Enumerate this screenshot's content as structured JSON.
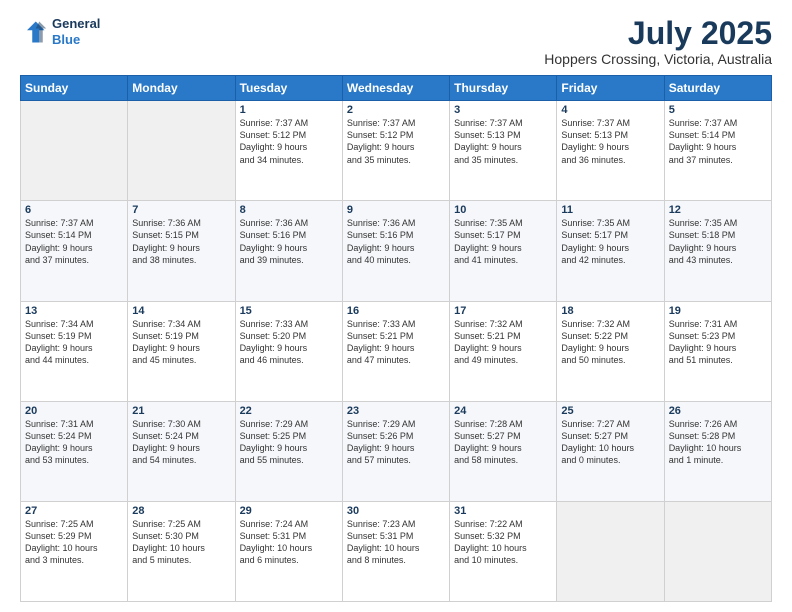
{
  "header": {
    "logo_line1": "General",
    "logo_line2": "Blue",
    "month_year": "July 2025",
    "location": "Hoppers Crossing, Victoria, Australia"
  },
  "days_of_week": [
    "Sunday",
    "Monday",
    "Tuesday",
    "Wednesday",
    "Thursday",
    "Friday",
    "Saturday"
  ],
  "weeks": [
    [
      {
        "day": "",
        "content": ""
      },
      {
        "day": "",
        "content": ""
      },
      {
        "day": "1",
        "content": "Sunrise: 7:37 AM\nSunset: 5:12 PM\nDaylight: 9 hours\nand 34 minutes."
      },
      {
        "day": "2",
        "content": "Sunrise: 7:37 AM\nSunset: 5:12 PM\nDaylight: 9 hours\nand 35 minutes."
      },
      {
        "day": "3",
        "content": "Sunrise: 7:37 AM\nSunset: 5:13 PM\nDaylight: 9 hours\nand 35 minutes."
      },
      {
        "day": "4",
        "content": "Sunrise: 7:37 AM\nSunset: 5:13 PM\nDaylight: 9 hours\nand 36 minutes."
      },
      {
        "day": "5",
        "content": "Sunrise: 7:37 AM\nSunset: 5:14 PM\nDaylight: 9 hours\nand 37 minutes."
      }
    ],
    [
      {
        "day": "6",
        "content": "Sunrise: 7:37 AM\nSunset: 5:14 PM\nDaylight: 9 hours\nand 37 minutes."
      },
      {
        "day": "7",
        "content": "Sunrise: 7:36 AM\nSunset: 5:15 PM\nDaylight: 9 hours\nand 38 minutes."
      },
      {
        "day": "8",
        "content": "Sunrise: 7:36 AM\nSunset: 5:16 PM\nDaylight: 9 hours\nand 39 minutes."
      },
      {
        "day": "9",
        "content": "Sunrise: 7:36 AM\nSunset: 5:16 PM\nDaylight: 9 hours\nand 40 minutes."
      },
      {
        "day": "10",
        "content": "Sunrise: 7:35 AM\nSunset: 5:17 PM\nDaylight: 9 hours\nand 41 minutes."
      },
      {
        "day": "11",
        "content": "Sunrise: 7:35 AM\nSunset: 5:17 PM\nDaylight: 9 hours\nand 42 minutes."
      },
      {
        "day": "12",
        "content": "Sunrise: 7:35 AM\nSunset: 5:18 PM\nDaylight: 9 hours\nand 43 minutes."
      }
    ],
    [
      {
        "day": "13",
        "content": "Sunrise: 7:34 AM\nSunset: 5:19 PM\nDaylight: 9 hours\nand 44 minutes."
      },
      {
        "day": "14",
        "content": "Sunrise: 7:34 AM\nSunset: 5:19 PM\nDaylight: 9 hours\nand 45 minutes."
      },
      {
        "day": "15",
        "content": "Sunrise: 7:33 AM\nSunset: 5:20 PM\nDaylight: 9 hours\nand 46 minutes."
      },
      {
        "day": "16",
        "content": "Sunrise: 7:33 AM\nSunset: 5:21 PM\nDaylight: 9 hours\nand 47 minutes."
      },
      {
        "day": "17",
        "content": "Sunrise: 7:32 AM\nSunset: 5:21 PM\nDaylight: 9 hours\nand 49 minutes."
      },
      {
        "day": "18",
        "content": "Sunrise: 7:32 AM\nSunset: 5:22 PM\nDaylight: 9 hours\nand 50 minutes."
      },
      {
        "day": "19",
        "content": "Sunrise: 7:31 AM\nSunset: 5:23 PM\nDaylight: 9 hours\nand 51 minutes."
      }
    ],
    [
      {
        "day": "20",
        "content": "Sunrise: 7:31 AM\nSunset: 5:24 PM\nDaylight: 9 hours\nand 53 minutes."
      },
      {
        "day": "21",
        "content": "Sunrise: 7:30 AM\nSunset: 5:24 PM\nDaylight: 9 hours\nand 54 minutes."
      },
      {
        "day": "22",
        "content": "Sunrise: 7:29 AM\nSunset: 5:25 PM\nDaylight: 9 hours\nand 55 minutes."
      },
      {
        "day": "23",
        "content": "Sunrise: 7:29 AM\nSunset: 5:26 PM\nDaylight: 9 hours\nand 57 minutes."
      },
      {
        "day": "24",
        "content": "Sunrise: 7:28 AM\nSunset: 5:27 PM\nDaylight: 9 hours\nand 58 minutes."
      },
      {
        "day": "25",
        "content": "Sunrise: 7:27 AM\nSunset: 5:27 PM\nDaylight: 10 hours\nand 0 minutes."
      },
      {
        "day": "26",
        "content": "Sunrise: 7:26 AM\nSunset: 5:28 PM\nDaylight: 10 hours\nand 1 minute."
      }
    ],
    [
      {
        "day": "27",
        "content": "Sunrise: 7:25 AM\nSunset: 5:29 PM\nDaylight: 10 hours\nand 3 minutes."
      },
      {
        "day": "28",
        "content": "Sunrise: 7:25 AM\nSunset: 5:30 PM\nDaylight: 10 hours\nand 5 minutes."
      },
      {
        "day": "29",
        "content": "Sunrise: 7:24 AM\nSunset: 5:31 PM\nDaylight: 10 hours\nand 6 minutes."
      },
      {
        "day": "30",
        "content": "Sunrise: 7:23 AM\nSunset: 5:31 PM\nDaylight: 10 hours\nand 8 minutes."
      },
      {
        "day": "31",
        "content": "Sunrise: 7:22 AM\nSunset: 5:32 PM\nDaylight: 10 hours\nand 10 minutes."
      },
      {
        "day": "",
        "content": ""
      },
      {
        "day": "",
        "content": ""
      }
    ]
  ]
}
